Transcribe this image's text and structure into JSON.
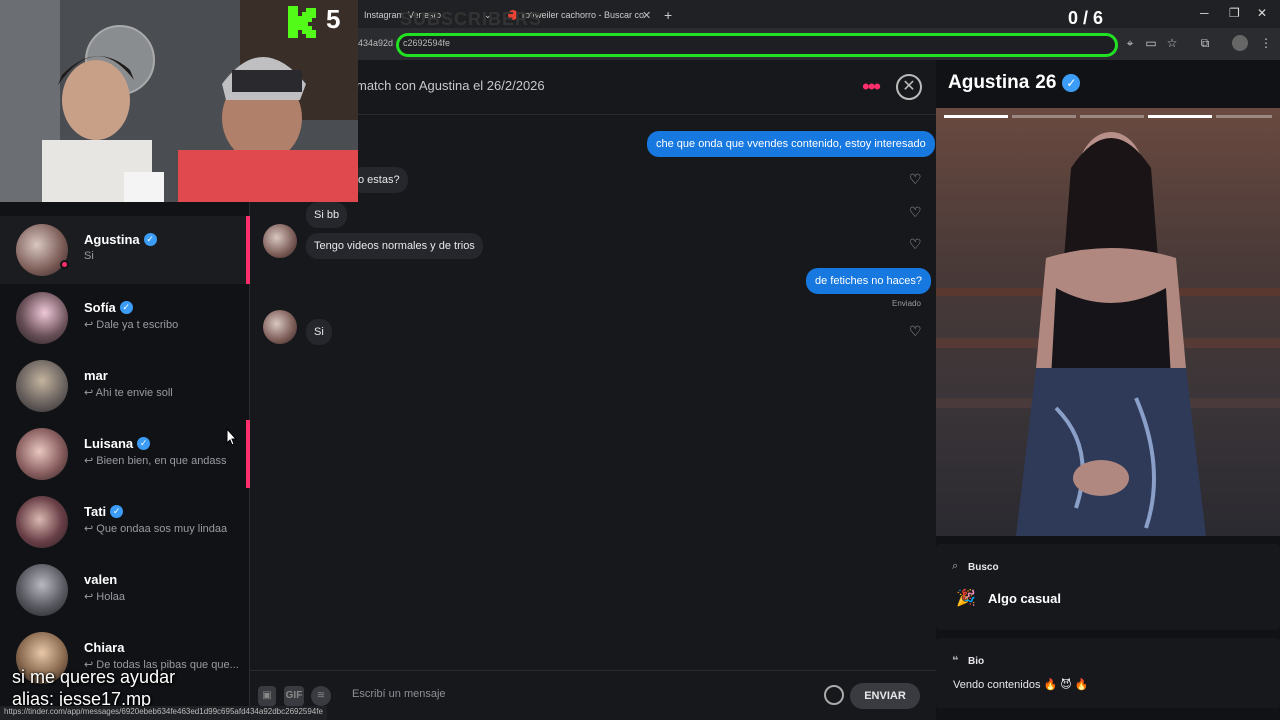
{
  "browser": {
    "tabs": [
      {
        "label": "Instagram"
      },
      {
        "label": "Ver esto"
      },
      {
        "label": "rottweiler cachorro - Buscar co"
      }
    ],
    "url_left": "434a92d",
    "url_text": "c2692594fe",
    "status_url": "https://tinder.com/app/messages/6920ebeb634fe463ed1d99c695afd434a92dbc2692594fe"
  },
  "overlay": {
    "subscribers_label": "SUBSCRIBERS",
    "sub_count": "5",
    "counter": "0 / 6",
    "caption_line1": "si me queres ayudar",
    "caption_line2": "alias: jesse17.mp"
  },
  "sidebar": {
    "conversations": [
      {
        "name": "Agustina",
        "verified": true,
        "preview": "Si",
        "active": true
      },
      {
        "name": "Sofía",
        "verified": true,
        "preview": "↩ Dale ya t escribo"
      },
      {
        "name": "mar",
        "verified": false,
        "preview": "↩ Ahi te envie soll"
      },
      {
        "name": "Luisana",
        "verified": true,
        "preview": "↩ Bieen bien, en que andass"
      },
      {
        "name": "Tati",
        "verified": true,
        "preview": "↩ Que ondaa sos muy lindaa"
      },
      {
        "name": "valen",
        "verified": false,
        "preview": "↩ Holaa"
      },
      {
        "name": "Chiara",
        "verified": false,
        "preview": "↩ De todas las pibas que que..."
      }
    ]
  },
  "chat": {
    "match_title": "match con Agustina el 26/2/2026",
    "messages": [
      {
        "dir": "out",
        "text": "che que onda que vvendes contenido, estoy interesado"
      },
      {
        "dir": "in",
        "text": "o estas?"
      },
      {
        "dir": "in",
        "text": "Si bb"
      },
      {
        "dir": "in",
        "text": "Tengo videos normales y de trios"
      },
      {
        "dir": "out",
        "text": "de fetiches no haces?"
      },
      {
        "dir": "in",
        "text": "Si"
      }
    ],
    "sent_label": "Enviado",
    "composer_placeholder": "Escribí un mensaje",
    "gif_label": "GIF",
    "send_label": "ENVIAR"
  },
  "profile": {
    "name": "Agustina",
    "age": "26",
    "looking_for_label": "Busco",
    "looking_for_value": "Algo casual",
    "bio_label": "Bio",
    "bio_text": "Vendo contenidos 🔥 😈 🔥"
  },
  "colors": {
    "brand": "#fd2e6b",
    "sent_bubble": "#1778e0",
    "verified": "#3b9df8",
    "highlight": "#22e022"
  }
}
